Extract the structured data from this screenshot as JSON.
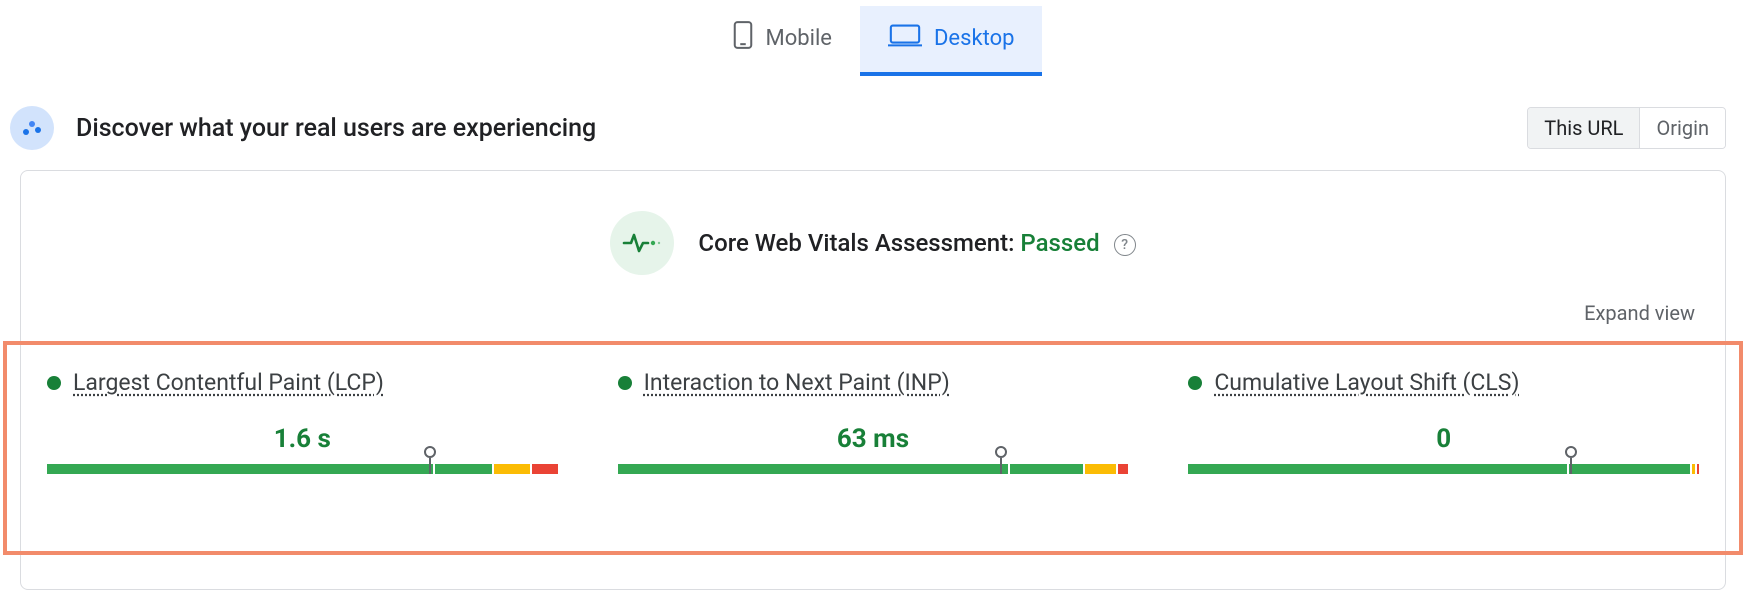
{
  "tabs": {
    "mobile": "Mobile",
    "desktop": "Desktop",
    "active": "desktop"
  },
  "header": {
    "title": "Discover what your real users are experiencing",
    "scope": {
      "this_url": "This URL",
      "origin": "Origin",
      "active": "this_url"
    }
  },
  "assessment": {
    "prefix": "Core Web Vitals Assessment:",
    "status": "Passed"
  },
  "expand_label": "Expand view",
  "metrics": [
    {
      "id": "lcp",
      "name": "Largest Contentful Paint (LCP)",
      "value": "1.6 s",
      "status": "good",
      "pin_percent": 75,
      "segments": [
        {
          "class": "green",
          "flex": 75
        },
        {
          "class": "green",
          "flex": 11
        },
        {
          "class": "orange",
          "flex": 7
        },
        {
          "class": "red",
          "flex": 5
        }
      ]
    },
    {
      "id": "inp",
      "name": "Interaction to Next Paint (INP)",
      "value": "63 ms",
      "status": "good",
      "pin_percent": 75,
      "segments": [
        {
          "class": "green",
          "flex": 75
        },
        {
          "class": "green",
          "flex": 14
        },
        {
          "class": "orange",
          "flex": 6
        },
        {
          "class": "red",
          "flex": 2
        }
      ]
    },
    {
      "id": "cls",
      "name": "Cumulative Layout Shift (CLS)",
      "value": "0",
      "status": "good",
      "pin_percent": 75,
      "segments": [
        {
          "class": "green",
          "flex": 75
        },
        {
          "class": "green",
          "flex": 24
        },
        {
          "class": "orange",
          "flex": 0.6
        },
        {
          "class": "red",
          "flex": 0.4
        }
      ]
    }
  ],
  "colors": {
    "good": "#188038",
    "warn": "#fbbc04",
    "bad": "#ea4335",
    "accent": "#1a73e8"
  }
}
